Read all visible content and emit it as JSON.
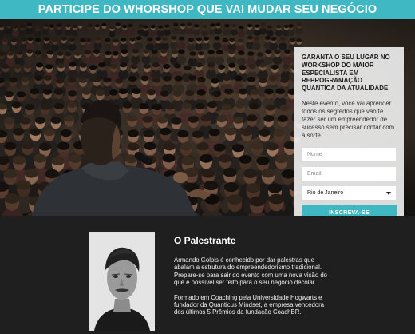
{
  "topbar": {
    "title": "PARTICIPE DO WHORSHOP QUE VAI MUDAR SEU NEGÓCIO"
  },
  "form": {
    "title": "GARANTA O SEU LUGAR NO WORKSHOP DO MAIOR ESPECIALISTA EM REPROGRAMAÇÃO QUANTICA DA ATUALIDADE",
    "description": "Neste evento, você vai aprender todos os segredos que vão te fazer ser um empreendedor de sucesso sem precisar contar com a sorte",
    "name_placeholder": "Nome",
    "email_placeholder": "Email",
    "city_selected": "Rio de Janeiro",
    "submit_label": "INSCREVA-SE"
  },
  "speaker": {
    "heading": "O Palestrante",
    "bio_1": "Armando Golpis é conhecido por dar palestras que abalam a estrutura do empreendedorismo tradicional. Prepare-se para sair do evento com uma nova visão do que é possível ser feito para o seu negócio decolar.",
    "bio_2": "Formado em Coaching pela Universidade Hogwarts e fundador da Quanticus Mindset, a empresa vencedora dos últimos 5 Prêmios da fundação CoachBR."
  },
  "colors": {
    "accent": "#3fb8c4",
    "dark_bg": "#1f1f1f"
  },
  "icons": {
    "select_caret": "chevron-down-icon"
  }
}
